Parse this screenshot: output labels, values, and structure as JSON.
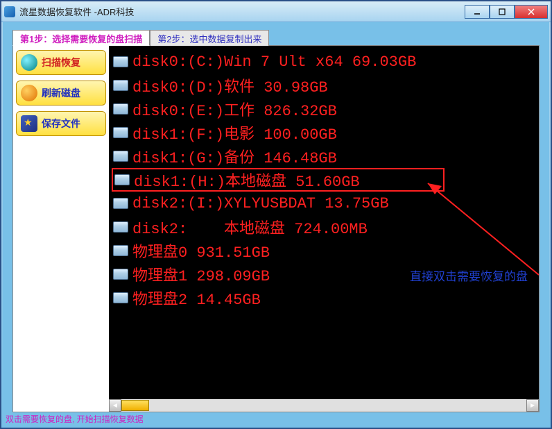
{
  "window": {
    "title": "流星数据恢复软件   -ADR科技"
  },
  "tabs": {
    "step1": "第1步：选择需要恢复的盘扫描",
    "step2": "第2步：选中数据复制出来"
  },
  "sidebar": {
    "scan_label": "扫描恢复",
    "refresh_label": "刷新磁盘",
    "save_label": "保存文件"
  },
  "disks": [
    {
      "text": "disk0:(C:)Win 7 Ult x64 69.03GB",
      "highlight": false
    },
    {
      "text": "disk0:(D:)软件 30.98GB",
      "highlight": false
    },
    {
      "text": "disk0:(E:)工作 826.32GB",
      "highlight": false
    },
    {
      "text": "disk1:(F:)电影 100.00GB",
      "highlight": false
    },
    {
      "text": "disk1:(G:)备份 146.48GB",
      "highlight": false
    },
    {
      "text": "disk1:(H:)本地磁盘 51.60GB",
      "highlight": true
    },
    {
      "text": "disk2:(I:)XYLYUSBDAT 13.75GB",
      "highlight": false
    },
    {
      "text": "disk2:    本地磁盘 724.00MB",
      "highlight": false
    },
    {
      "text": "物理盘0 931.51GB",
      "highlight": false
    },
    {
      "text": "物理盘1 298.09GB",
      "highlight": false
    },
    {
      "text": "物理盘2 14.45GB",
      "highlight": false
    }
  ],
  "annotation": "直接双击需要恢复的盘",
  "status": "双击需要恢复的盘, 开始扫描恢复数据"
}
